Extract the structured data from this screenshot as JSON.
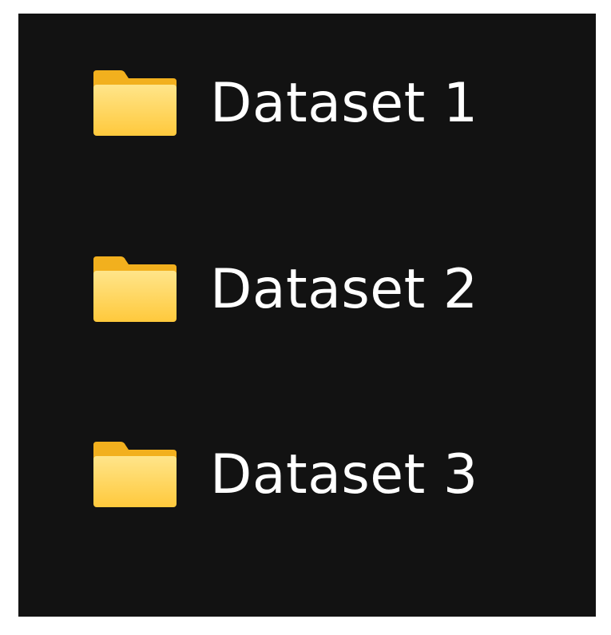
{
  "folders": [
    {
      "label": "Dataset 1",
      "icon": "folder-icon"
    },
    {
      "label": "Dataset 2",
      "icon": "folder-icon"
    },
    {
      "label": "Dataset 3",
      "icon": "folder-icon"
    }
  ],
  "colors": {
    "background": "#121212",
    "folder_front": "#FFD54F",
    "folder_back": "#F2B01E",
    "text": "#FFFFFF"
  }
}
